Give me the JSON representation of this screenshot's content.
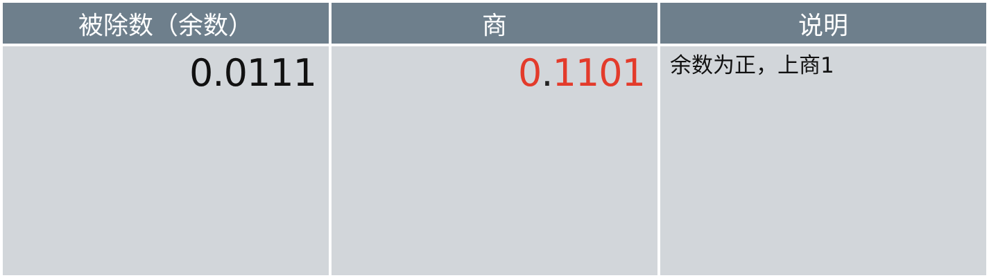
{
  "table": {
    "headers": [
      "被除数（余数）",
      "商",
      "说明"
    ],
    "dividend": "0.0111",
    "quotient_int": "0",
    "quotient_dot": ".",
    "quotient_frac": "1101",
    "note": "余数为正，上商1",
    "colors": {
      "header_bg": "#6e7f8c",
      "cell_bg": "#d2d6da",
      "quotient": "#e33b2b"
    }
  }
}
